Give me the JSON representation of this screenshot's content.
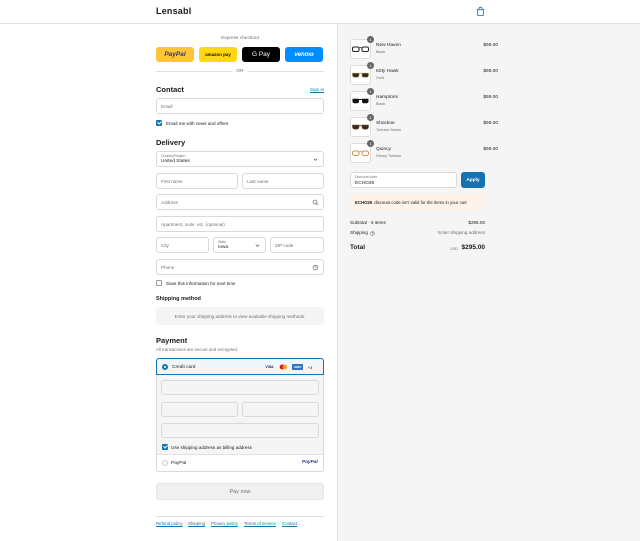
{
  "header": {
    "brand": "Lensabl",
    "cart_icon": "shopping-bag-icon"
  },
  "express": {
    "title": "Express checkout",
    "buttons": [
      {
        "label": "PayPal",
        "bg": "#ffc439",
        "fg": "#253b80"
      },
      {
        "label": "amazon pay",
        "bg": "#ffd814",
        "fg": "#111111"
      },
      {
        "label": "G Pay",
        "bg": "#000000",
        "fg": "#ffffff"
      },
      {
        "label": "venmo",
        "bg": "#008cff",
        "fg": "#ffffff"
      }
    ],
    "or": "OR"
  },
  "contact": {
    "title": "Contact",
    "sign_in": "Sign in",
    "email_placeholder": "Email",
    "news_label": "Email me with news and offers",
    "news_checked": true
  },
  "delivery": {
    "title": "Delivery",
    "country_label": "Country/Region",
    "country_value": "United States",
    "first_name": "First name",
    "last_name": "Last name",
    "address": "Address",
    "apartment": "Apartment, suite, etc. (optional)",
    "city": "City",
    "state_label": "State",
    "state_value": "Iowa",
    "zip": "ZIP code",
    "phone": "Phone",
    "save_label": "Save this information for next time",
    "save_checked": false
  },
  "shipping_method": {
    "title": "Shipping method",
    "message": "Enter your shipping address to view available shipping methods."
  },
  "payment": {
    "title": "Payment",
    "subtitle": "All transactions are secure and encrypted.",
    "credit_card": "Credit card",
    "card_brands": [
      "VISA",
      "MC",
      "AMEX"
    ],
    "more_brands": "+3",
    "billing_label": "Use shipping address as billing address",
    "paypal": "PayPal",
    "pay_now": "Pay now"
  },
  "footer": {
    "links": [
      "Refund policy",
      "Shipping",
      "Privacy policy",
      "Terms of service",
      "Contact"
    ]
  },
  "summary": {
    "items": [
      {
        "name": "New Haven",
        "variant": "Black",
        "price": "$59.00",
        "qty": "1"
      },
      {
        "name": "Kitty Hawk",
        "variant": "Gold",
        "price": "$59.00",
        "qty": "1"
      },
      {
        "name": "Hamptons",
        "variant": "Black",
        "price": "$59.00",
        "qty": "1"
      },
      {
        "name": "Shockoe",
        "variant": "Tortoise Brown",
        "price": "$59.00",
        "qty": "1"
      },
      {
        "name": "Quincy",
        "variant": "Honey Tortoise",
        "price": "$59.00",
        "qty": "1"
      }
    ],
    "discount_label": "Discount code",
    "discount_value": "ECHO25",
    "apply": "Apply",
    "error_code": "ECHO25",
    "error_text": "discount code isn't valid for the items in your cart",
    "subtotal_label": "Subtotal · 5 items",
    "subtotal_value": "$295.00",
    "shipping_label": "Shipping",
    "shipping_value": "Enter shipping address",
    "total_label": "Total",
    "currency": "USD",
    "total_value": "$295.00"
  },
  "colors": {
    "accent": "#1773b0",
    "error_bg": "#fff2e8"
  }
}
